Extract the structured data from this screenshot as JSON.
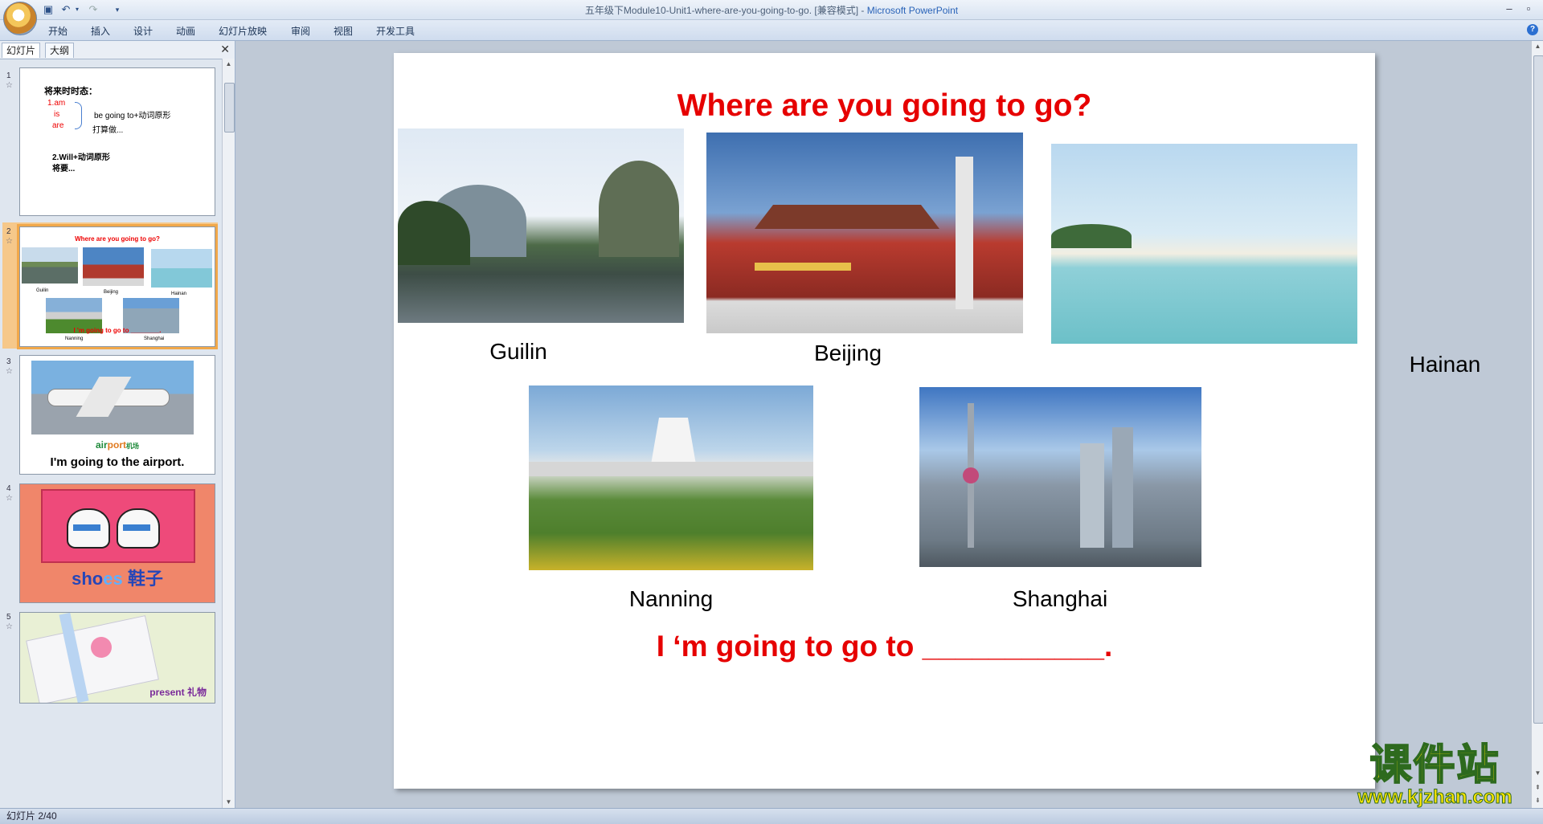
{
  "window": {
    "title": "五年级下Module10-Unit1-where-are-you-going-to-go. [兼容模式] - ",
    "app": "Microsoft PowerPoint"
  },
  "ribbon": {
    "tabs": [
      "开始",
      "插入",
      "设计",
      "动画",
      "幻灯片放映",
      "审阅",
      "视图",
      "开发工具"
    ]
  },
  "panel": {
    "tabs": [
      "幻灯片",
      "大纲"
    ],
    "thumbs": [
      {
        "num": "1",
        "line1": "将来时时态：",
        "am": "1.am",
        "is": "is",
        "are": "are",
        "bgt": "be going to+动词原形",
        "plan": "打算做...",
        "will": "2.Will+动词原形",
        "will2": "将要..."
      },
      {
        "num": "2",
        "title": "Where are you going to go?",
        "c1": "Guilin",
        "c2": "Beijing",
        "c3": "Hainan",
        "c4": "Nanning",
        "c5": "Shanghai",
        "bottom": "I 'm going to go to ________."
      },
      {
        "num": "3",
        "word_a": "air",
        "word_b": "port",
        "word_cn": "机场",
        "sentence": "I'm going to the airport."
      },
      {
        "num": "4",
        "word_a": "sho",
        "word_b": "es",
        "word_cn": "鞋子"
      },
      {
        "num": "5",
        "word": "present",
        "word_cn": "礼物"
      }
    ]
  },
  "slide": {
    "title": "Where are you going to go?",
    "cities": [
      "Guilin",
      "Beijing",
      "Hainan",
      "Nanning",
      "Shanghai"
    ],
    "bottom_prefix": "I ‘m going to go to ",
    "bottom_blank": "___________",
    "bottom_suffix": "."
  },
  "status": {
    "slide_counter": "幻灯片 2/40"
  },
  "watermark": {
    "cn": "课件站",
    "url": "www.kjzhan.com"
  }
}
